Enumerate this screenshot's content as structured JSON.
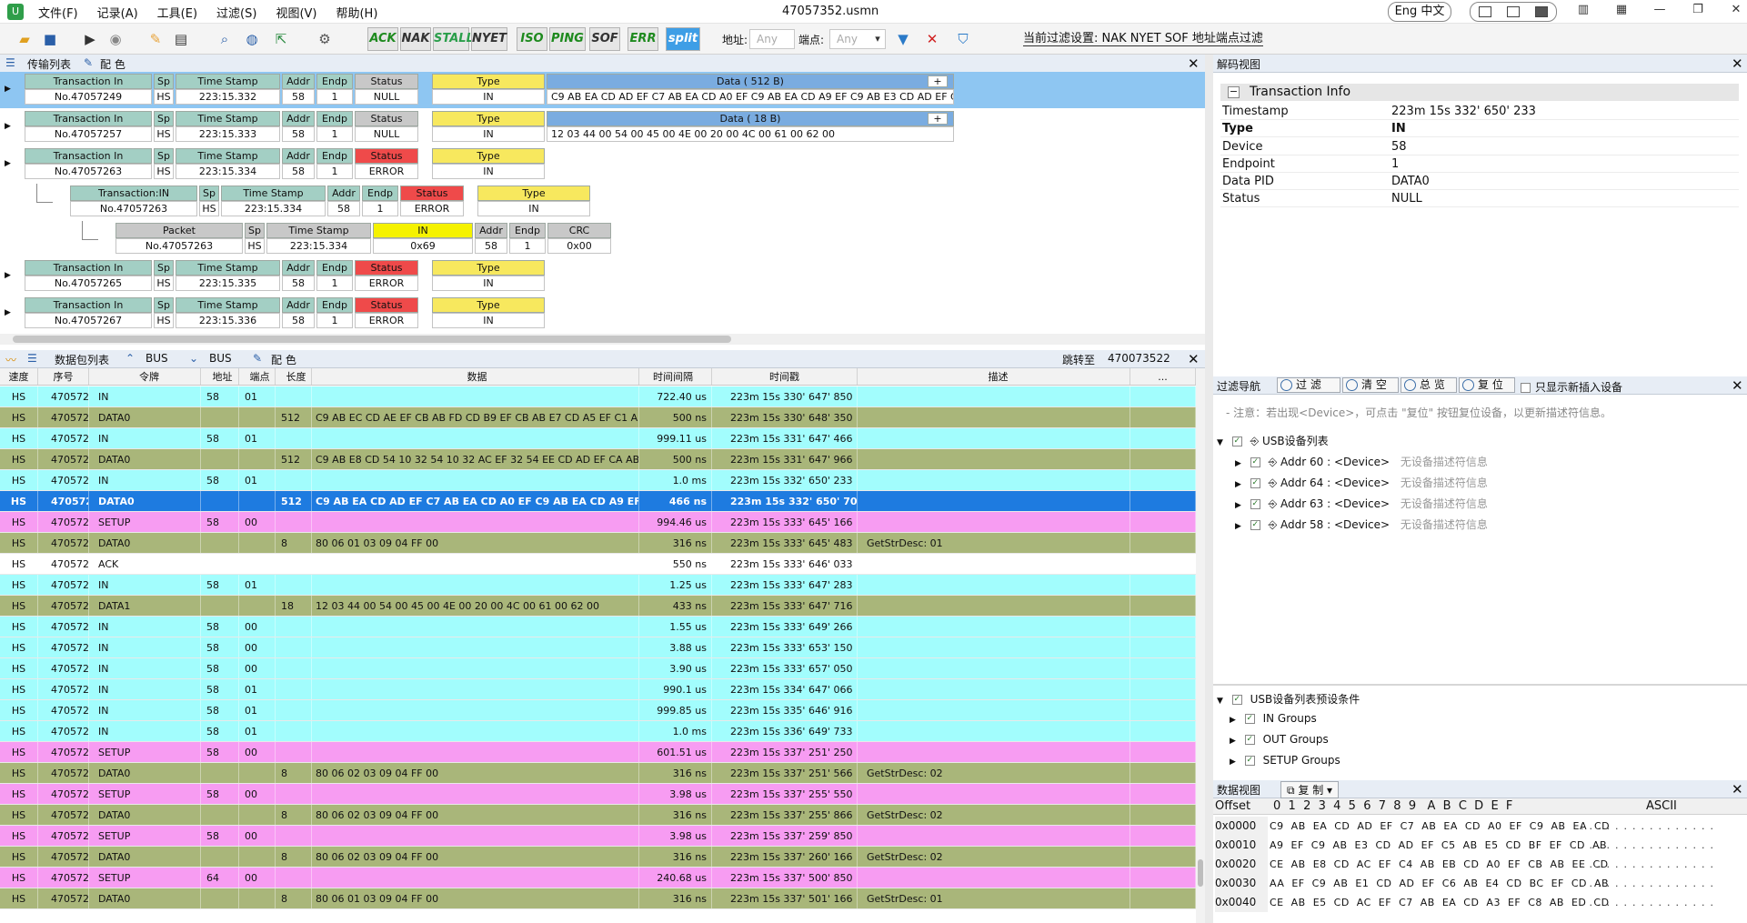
{
  "app": {
    "window_title": "47057352.usmn",
    "menu": [
      "文件(F)",
      "记录(A)",
      "工具(E)",
      "过滤(S)",
      "视图(V)",
      "帮助(H)"
    ],
    "lang": "Eng 中文",
    "icon_letter": "U"
  },
  "toolbar": {
    "pid_buttons": [
      "ACK",
      "NAK",
      "STALL",
      "NYET",
      "ISO",
      "PING",
      "SOF",
      "ERR",
      "split"
    ],
    "addr_label": "地址:",
    "addr_value": "Any",
    "endp_label": "端点:",
    "endp_value": "Any",
    "current_filter": "当前过滤设置:   NAK NYET SOF   地址端点过滤"
  },
  "transfer_panel": {
    "tabs": [
      "传输列表",
      "配 色"
    ],
    "headers": {
      "transaction": "Transaction In",
      "sp": "Sp",
      "timestamp": "Time Stamp",
      "addr": "Addr",
      "endp": "Endp",
      "status": "Status",
      "type": "Type",
      "data512": "Data ( 512 B)",
      "data18": "Data ( 18 B)",
      "txin": "Transaction:IN",
      "packet": "Packet",
      "in": "IN",
      "crc": "CRC"
    },
    "rows": [
      {
        "no": "No.47057249",
        "sp": "HS",
        "ts": "223:15.332",
        "addr": "58",
        "endp": "1",
        "status": "NULL",
        "type": "IN",
        "data": "C9 AB EA CD AD EF C7 AB EA CD A0 EF C9 AB EA CD A9 EF C9 AB E3 CD AD EF C5 AB E5..."
      },
      {
        "no": "No.47057257",
        "sp": "HS",
        "ts": "223:15.333",
        "addr": "58",
        "endp": "1",
        "status": "NULL",
        "type": "IN",
        "data": "12 03 44 00 54 00 45 00 4E 00 20 00 4C 00 61 00 62 00"
      },
      {
        "no": "No.47057263",
        "sp": "HS",
        "ts": "223:15.334",
        "addr": "58",
        "endp": "1",
        "status": "ERROR",
        "type": "IN"
      },
      {
        "no": "No.47057263",
        "sp": "HS",
        "ts": "223:15.334",
        "addr": "58",
        "endp": "1",
        "status": "ERROR",
        "type": "IN"
      },
      {
        "no": "No.47057263",
        "sp": "HS",
        "ts": "223:15.334",
        "pid": "0x69",
        "addr": "58",
        "endp": "1",
        "crc": "0x00"
      },
      {
        "no": "No.47057265",
        "sp": "HS",
        "ts": "223:15.335",
        "addr": "58",
        "endp": "1",
        "status": "ERROR",
        "type": "IN"
      },
      {
        "no": "No.47057267",
        "sp": "HS",
        "ts": "223:15.336",
        "addr": "58",
        "endp": "1",
        "status": "ERROR",
        "type": "IN"
      }
    ],
    "plus": "+"
  },
  "packet_panel": {
    "tabs": [
      "数据包列表",
      "BUS",
      "BUS",
      "配 色"
    ],
    "jump_label": "跳转至",
    "jump_value": "470073522",
    "columns": [
      "速度",
      "序号",
      "令牌",
      "地址",
      "端点",
      "长度",
      "数据",
      "时间间隔",
      "时间戳",
      "描述",
      "..."
    ],
    "rows": [
      [
        "HS",
        "47057243",
        "IN",
        "58",
        "01",
        "",
        "",
        "722.40 us",
        "223m 15s 330' 647' 850",
        ""
      ],
      [
        "HS",
        "47057244",
        "DATA0",
        "",
        "",
        "512",
        "C9 AB EC CD AE EF CB AB FD CD B9 EF CB AB E7 CD A5 EF C1 AB E5 CD",
        "500 ns",
        "223m 15s 330' 648' 350",
        ""
      ],
      [
        "HS",
        "47057246",
        "IN",
        "58",
        "01",
        "",
        "",
        "999.11 us",
        "223m 15s 331' 647' 466",
        ""
      ],
      [
        "HS",
        "47057247",
        "DATA0",
        "",
        "",
        "512",
        "C9 AB E8 CD 54 10 32 54 10 32 AC EF 32 54 EE CD AD EF CA AB E9 CD A",
        "500 ns",
        "223m 15s 331' 647' 966",
        ""
      ],
      [
        "HS",
        "47057249",
        "IN",
        "58",
        "01",
        "",
        "",
        "1.0 ms",
        "223m 15s 332' 650' 233",
        ""
      ],
      [
        "HS",
        "47057250",
        "DATA0",
        "",
        "",
        "512",
        "C9 AB EA CD AD EF C7 AB EA CD A0 EF C9 AB EA CD A9 EF C9 AB E3 CD",
        "466 ns",
        "223m 15s 332' 650' 700",
        ""
      ],
      [
        "HS",
        "47057254",
        "SETUP",
        "58",
        "00",
        "",
        "",
        "994.46 us",
        "223m 15s 333' 645' 166",
        ""
      ],
      [
        "HS",
        "47057255",
        "DATA0",
        "",
        "",
        "8",
        "80 06 01 03 09 04 FF 00",
        "316 ns",
        "223m 15s 333' 645' 483",
        "GetStrDesc: 01"
      ],
      [
        "HS",
        "47057256",
        "ACK",
        "",
        "",
        "",
        "",
        "550 ns",
        "223m 15s 333' 646' 033",
        ""
      ],
      [
        "HS",
        "47057257",
        "IN",
        "58",
        "01",
        "",
        "",
        "1.25 us",
        "223m 15s 333' 647' 283",
        ""
      ],
      [
        "HS",
        "47057258",
        "DATA1",
        "",
        "",
        "18",
        "12 03 44 00 54 00 45 00 4E 00 20 00 4C 00 61 00 62 00",
        "433 ns",
        "223m 15s 333' 647' 716",
        ""
      ],
      [
        "HS",
        "47057259",
        "IN",
        "58",
        "00",
        "",
        "",
        "1.55 us",
        "223m 15s 333' 649' 266",
        ""
      ],
      [
        "HS",
        "47057260",
        "IN",
        "58",
        "00",
        "",
        "",
        "3.88 us",
        "223m 15s 333' 653' 150",
        ""
      ],
      [
        "HS",
        "47057261",
        "IN",
        "58",
        "00",
        "",
        "",
        "3.90 us",
        "223m 15s 333' 657' 050",
        ""
      ],
      [
        "HS",
        "47057263",
        "IN",
        "58",
        "01",
        "",
        "",
        "990.1 us",
        "223m 15s 334' 647' 066",
        ""
      ],
      [
        "HS",
        "47057265",
        "IN",
        "58",
        "01",
        "",
        "",
        "999.85 us",
        "223m 15s 335' 646' 916",
        ""
      ],
      [
        "HS",
        "47057267",
        "IN",
        "58",
        "01",
        "",
        "",
        "1.0 ms",
        "223m 15s 336' 649' 733",
        ""
      ],
      [
        "HS",
        "47057271",
        "SETUP",
        "58",
        "00",
        "",
        "",
        "601.51 us",
        "223m 15s 337' 251' 250",
        ""
      ],
      [
        "HS",
        "47057272",
        "DATA0",
        "",
        "",
        "8",
        "80 06 02 03 09 04 FF 00",
        "316 ns",
        "223m 15s 337' 251' 566",
        "GetStrDesc: 02"
      ],
      [
        "HS",
        "47057273",
        "SETUP",
        "58",
        "00",
        "",
        "",
        "3.98 us",
        "223m 15s 337' 255' 550",
        ""
      ],
      [
        "HS",
        "47057274",
        "DATA0",
        "",
        "",
        "8",
        "80 06 02 03 09 04 FF 00",
        "316 ns",
        "223m 15s 337' 255' 866",
        "GetStrDesc: 02"
      ],
      [
        "HS",
        "47057275",
        "SETUP",
        "58",
        "00",
        "",
        "",
        "3.98 us",
        "223m 15s 337' 259' 850",
        ""
      ],
      [
        "HS",
        "47057276",
        "DATA0",
        "",
        "",
        "8",
        "80 06 02 03 09 04 FF 00",
        "316 ns",
        "223m 15s 337' 260' 166",
        "GetStrDesc: 02"
      ],
      [
        "HS",
        "47057278",
        "SETUP",
        "64",
        "00",
        "",
        "",
        "240.68 us",
        "223m 15s 337' 500' 850",
        ""
      ],
      [
        "HS",
        "47057279",
        "DATA0",
        "",
        "",
        "8",
        "80 06 01 03 09 04 FF 00",
        "316 ns",
        "223m 15s 337' 501' 166",
        "GetStrDesc: 01"
      ]
    ],
    "colors": {
      "IN": "#a2fdfd",
      "DATA": "#a9b67a",
      "SETUP": "#f79cf2",
      "ACK": "#ffffff",
      "SELECTED": "#1e7be0"
    }
  },
  "decode_panel": {
    "title": "解码视图",
    "section": "Transaction Info",
    "fields": [
      {
        "k": "Timestamp",
        "v": "223m 15s 332' 650' 233"
      },
      {
        "k": "Type",
        "v": "IN"
      },
      {
        "k": "Device",
        "v": "58"
      },
      {
        "k": "Endpoint",
        "v": "1"
      },
      {
        "k": "Data PID",
        "v": "DATA0"
      },
      {
        "k": "Status",
        "v": "NULL"
      }
    ]
  },
  "filter_nav": {
    "title": "过滤导航",
    "buttons": [
      "过 滤",
      "清 空",
      "总 览",
      "复 位"
    ],
    "check_label": "只显示新插入设备",
    "note": "- 注意：若出现<Device>，可点击 \"复位\" 按钮复位设备，以更新描述符信息。",
    "root": "USB设备列表",
    "devices": [
      {
        "label": "Addr 60 : <Device>",
        "desc": "无设备描述符信息"
      },
      {
        "label": "Addr 64 : <Device>",
        "desc": "无设备描述符信息"
      },
      {
        "label": "Addr 63 : <Device>",
        "desc": "无设备描述符信息"
      },
      {
        "label": "Addr 58 : <Device>",
        "desc": "无设备描述符信息"
      }
    ],
    "preset_root": "USB设备列表预设条件",
    "presets": [
      "IN Groups",
      "OUT Groups",
      "SETUP Groups"
    ]
  },
  "hex_view": {
    "title": "数据视图",
    "copy_label": "复 制",
    "offset_label": "Offset",
    "cols": "0  1  2  3  4  5  6  7  8  9   A  B  C  D  E  F",
    "ascii_label": "ASCII",
    "rows": [
      {
        "o": "0x0000",
        "h": "C9 AB EA CD AD EF C7 AB EA CD A0 EF C9 AB EA CD",
        "a": "................"
      },
      {
        "o": "0x0010",
        "h": "A9 EF C9 AB E3 CD AD EF C5 AB E5 CD BF EF CD AB",
        "a": "................"
      },
      {
        "o": "0x0020",
        "h": "CE AB E8 CD AC EF C4 AB EB CD A0 EF CB AB EE CD",
        "a": "................"
      },
      {
        "o": "0x0030",
        "h": "AA EF C9 AB E1 CD AD EF C6 AB E4 CD BC EF CD AB",
        "a": "................"
      },
      {
        "o": "0x0040",
        "h": "CE AB E5 CD AC EF C7 AB EA CD A3 EF C8 AB ED CD",
        "a": "................"
      }
    ]
  }
}
